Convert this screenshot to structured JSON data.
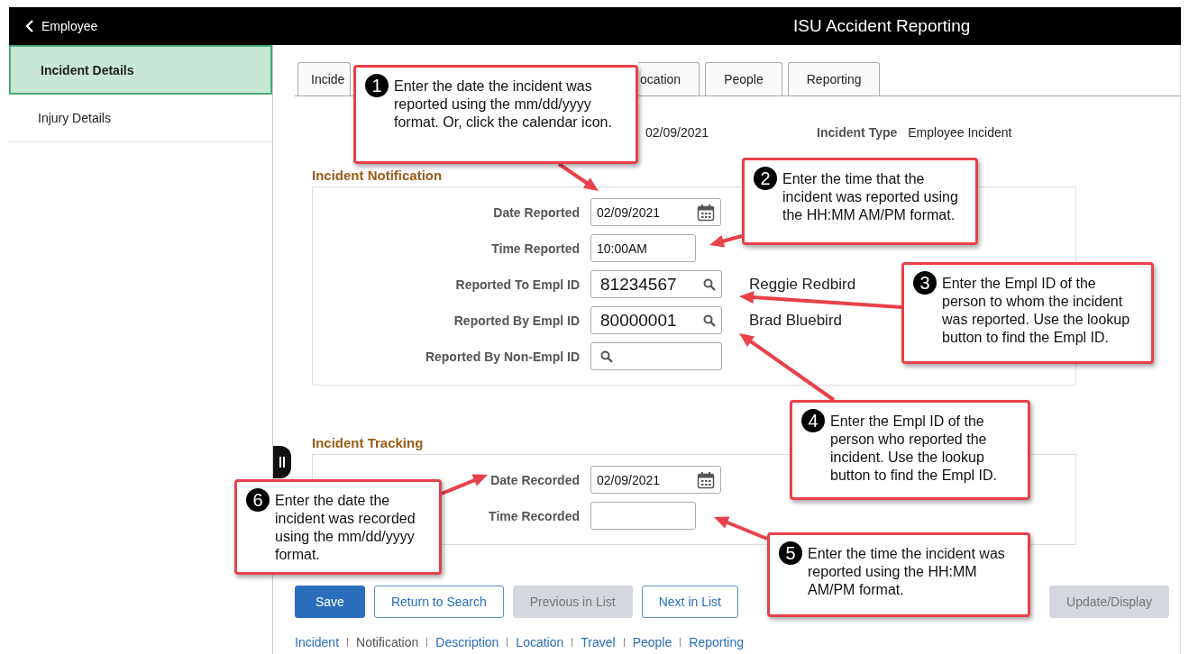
{
  "header": {
    "back_label": "Employee",
    "title": "ISU Accident Reporting"
  },
  "sidebar": {
    "items": [
      {
        "label": "Incident Details",
        "selected": true
      },
      {
        "label": "Injury Details",
        "selected": false
      }
    ]
  },
  "tabs": [
    {
      "label": "Incide",
      "selected": false
    },
    {
      "label": "ocation",
      "selected": false
    },
    {
      "label": "People",
      "selected": false
    },
    {
      "label": "Reporting",
      "selected": false
    }
  ],
  "summary": {
    "date": "02/09/2021",
    "type_label": "Incident Type",
    "type_value": "Employee Incident"
  },
  "sections": [
    {
      "title": "Incident Notification",
      "fields": [
        {
          "kind": "date",
          "label": "Date Reported",
          "value": "02/09/2021"
        },
        {
          "kind": "time",
          "label": "Time Reported",
          "value": "10:00AM"
        },
        {
          "kind": "lookup",
          "label": "Reported To Empl ID",
          "value": "81234567",
          "name": "Reggie Redbird"
        },
        {
          "kind": "lookup",
          "label": "Reported By Empl ID",
          "value": "80000001",
          "name": "Brad Bluebird"
        },
        {
          "kind": "lookup",
          "label": "Reported By Non-Empl ID"
        }
      ]
    },
    {
      "title": "Incident Tracking",
      "fields": [
        {
          "kind": "date",
          "label": "Date Recorded",
          "value": "02/09/2021"
        },
        {
          "kind": "time",
          "label": "Time Recorded"
        }
      ]
    }
  ],
  "buttons": [
    {
      "label": "Save",
      "kind": "primary"
    },
    {
      "label": "Return to Search",
      "kind": "secondary"
    },
    {
      "label": "Previous in List",
      "kind": "disabled"
    },
    {
      "label": "Next in List",
      "kind": "secondary"
    },
    {
      "label": "Update/Display",
      "kind": "disabled"
    }
  ],
  "links": [
    {
      "label": "Incident",
      "selected": false
    },
    {
      "label": "Notification",
      "selected": true
    },
    {
      "label": "Description",
      "selected": false
    },
    {
      "label": "Location",
      "selected": false
    },
    {
      "label": "Travel",
      "selected": false
    },
    {
      "label": "People",
      "selected": false
    },
    {
      "label": "Reporting",
      "selected": false
    }
  ],
  "callouts": [
    {
      "number": "1",
      "text": "Enter the date the incident was reported using the mm/dd/yyyy format. Or, click the calendar icon."
    },
    {
      "number": "2",
      "text": "Enter the time that the incident was reported using the HH:MM AM/PM format."
    },
    {
      "number": "3",
      "text": "Enter the Empl ID of the person to whom the incident was reported. Use the lookup button to find the Empl ID."
    },
    {
      "number": "4",
      "text": "Enter the Empl ID of the person who reported the incident. Use the lookup button to find the Empl ID."
    },
    {
      "number": "5",
      "text": "Enter the time the incident was reported using the HH:MM AM/PM format."
    },
    {
      "number": "6",
      "text": "Enter the date the incident was recorded using the mm/dd/yyyy format."
    }
  ]
}
